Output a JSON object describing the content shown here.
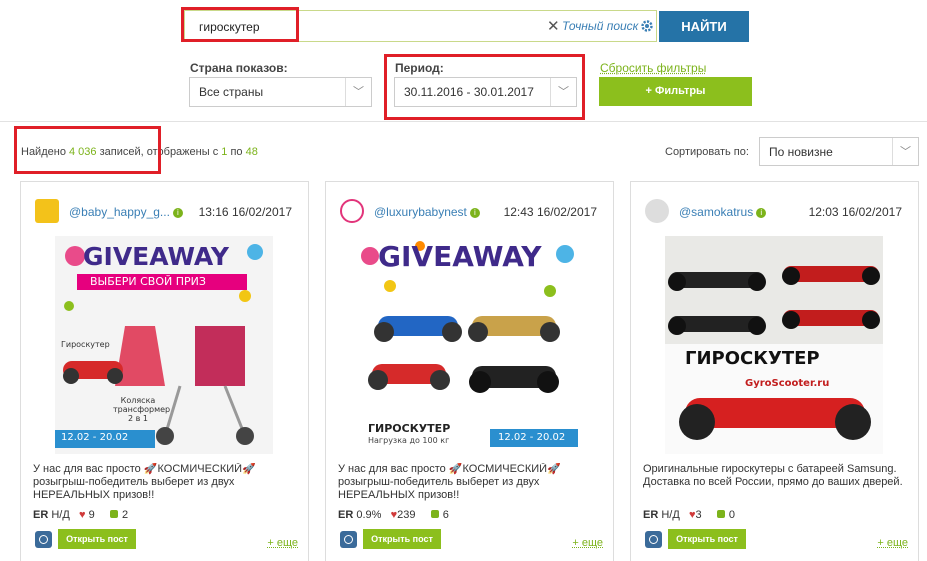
{
  "search": {
    "value": "гироскутер",
    "exact_label": "Точный поиск",
    "find_label": "НАЙТИ"
  },
  "filters": {
    "country_label": "Страна показов:",
    "country_value": "Все страны",
    "period_label": "Период:",
    "period_value": "30.11.2016 - 30.01.2017",
    "reset_label": "Сбросить фильтры",
    "filters_button": "+ Фильтры"
  },
  "results": {
    "prefix": "Найдено",
    "count": "4 036",
    "middle": "записей, отображены с",
    "from": "1",
    "to_word": "по",
    "to": "48"
  },
  "sort": {
    "label": "Сортировать по:",
    "value": "По новизне"
  },
  "cards": [
    {
      "handle": "@baby_happy_g...",
      "time": "13:16 16/02/2017",
      "caption": "У нас для вас просто 🚀КОСМИЧЕСКИЙ🚀 розыгрыш-победитель выберет из двух НЕРЕАЛЬНЫХ призов!!",
      "er_label": "ER",
      "er": "Н/Д",
      "likes": "9",
      "comments": "2",
      "open_label": "Открыть пост",
      "more_label": "+ еще",
      "img": {
        "giveaway": "GIVEAWAY",
        "choose": "ВЫБЕРИ СВОЙ ПРИЗ",
        "item1": "Гироскутер",
        "item2": "Коляска трансформер 2 в 1",
        "dates": "12.02 - 20.02"
      }
    },
    {
      "handle": "@luxurybabynest",
      "time": "12:43 16/02/2017",
      "caption": "У нас для вас просто 🚀КОСМИЧЕСКИЙ🚀 розыгрыш-победитель выберет из двух НЕРЕАЛЬНЫХ призов!!",
      "er_label": "ER",
      "er": "0.9%",
      "likes": "239",
      "comments": "6",
      "open_label": "Открыть пост",
      "more_label": "+ еще",
      "img": {
        "giveaway": "GIVEAWAY",
        "title": "ГИРОСКУТЕР",
        "sub": "Нагрузка до 100 кг",
        "dates": "12.02 - 20.02"
      }
    },
    {
      "handle": "@samokatrus",
      "time": "12:03 16/02/2017",
      "caption": "Оригинальные гироскутеры с батареей Samsung. Доставка по всей России, прямо до ваших дверей.",
      "er_label": "ER",
      "er": "Н/Д",
      "likes": "3",
      "comments": "0",
      "open_label": "Открыть пост",
      "more_label": "+ еще",
      "img": {
        "title": "ГИРОСКУТЕР",
        "brand": "GyroScooter.ru"
      }
    }
  ],
  "colors": {
    "accent_green": "#8cbf1d",
    "primary_blue": "#2573a7",
    "highlight_red": "#e01f28"
  }
}
